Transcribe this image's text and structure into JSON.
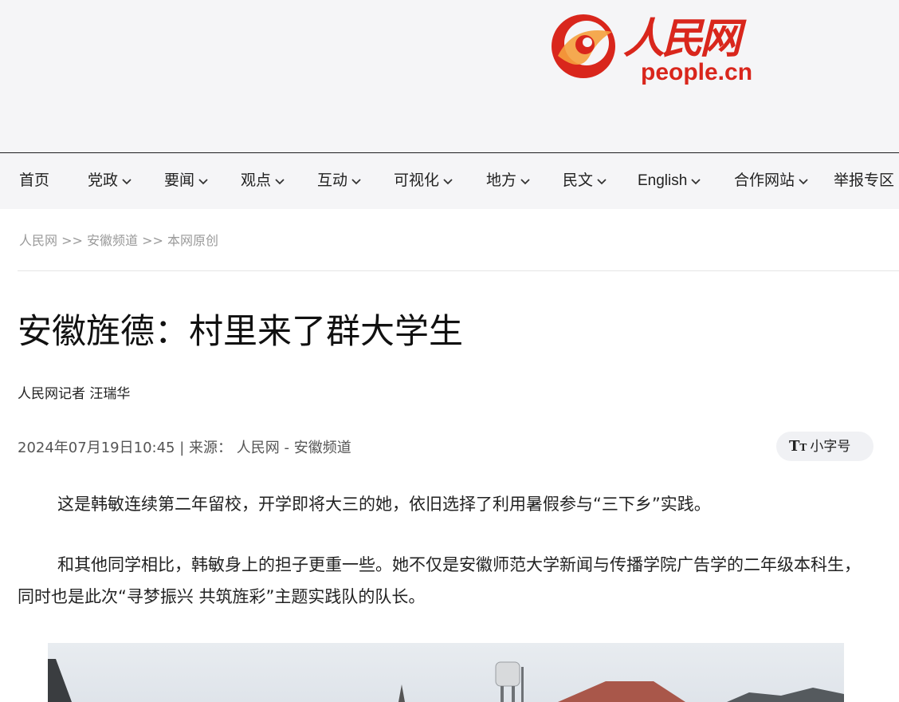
{
  "brand": {
    "logo_chinese": "人民网",
    "logo_domain": "people.cn",
    "red": "#d9261c",
    "orange": "#f5a13d"
  },
  "nav": {
    "items": [
      {
        "label": "首页",
        "has_dropdown": false
      },
      {
        "label": "党政",
        "has_dropdown": true
      },
      {
        "label": "要闻",
        "has_dropdown": true
      },
      {
        "label": "观点",
        "has_dropdown": true
      },
      {
        "label": "互动",
        "has_dropdown": true
      },
      {
        "label": "可视化",
        "has_dropdown": true
      },
      {
        "label": "地方",
        "has_dropdown": true
      },
      {
        "label": "民文",
        "has_dropdown": true
      },
      {
        "label": "English",
        "has_dropdown": true
      },
      {
        "label": "合作网站",
        "has_dropdown": true
      },
      {
        "label": "举报专区",
        "has_dropdown": false
      }
    ]
  },
  "breadcrumb": {
    "items": [
      "人民网",
      "安徽频道",
      "本网原创"
    ],
    "separator": ">>"
  },
  "article": {
    "title": "安徽旌德：村里来了群大学生",
    "author": "人民网记者 汪瑞华",
    "datetime": "2024年07月19日10:45",
    "source_label": "来源：",
    "source": "人民网 - 安徽频道",
    "font_toggle_label": "小字号",
    "paragraphs": [
      "这是韩敏连续第二年留校，开学即将大三的她，依旧选择了利用暑假参与“三下乡”实践。",
      "和其他同学相比，韩敏身上的担子更重一些。她不仅是安徽师范大学新闻与传播学院广告学的二年级本科生，同时也是此次“寻梦振兴 共筑旌彩”主题实践队的队长。"
    ]
  }
}
